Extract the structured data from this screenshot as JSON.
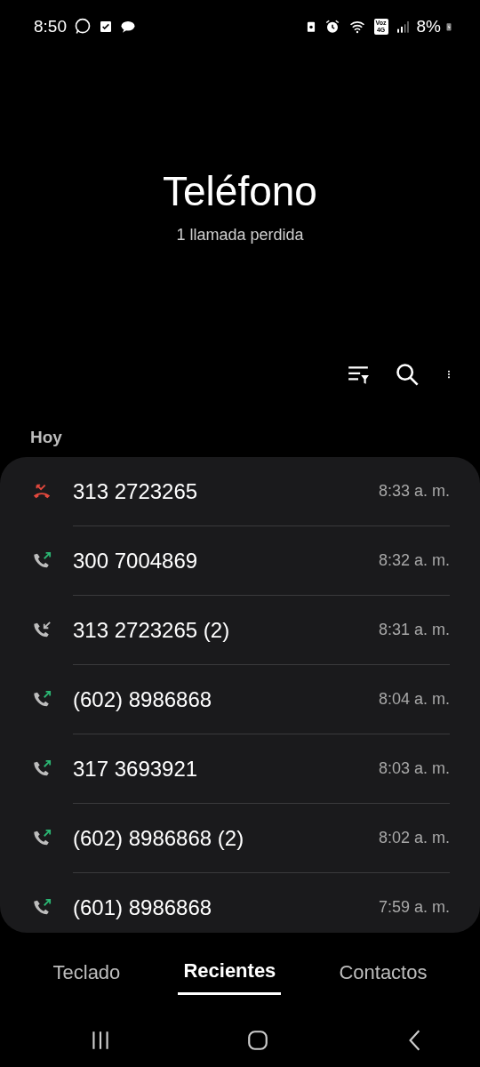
{
  "status_bar": {
    "time": "8:50",
    "network_label_top": "Voz",
    "network_label_bottom": "4G",
    "battery": "8%"
  },
  "header": {
    "title": "Teléfono",
    "subtitle": "1 llamada perdida"
  },
  "section": "Hoy",
  "calls": [
    {
      "kind": "missed",
      "number": "313 2723265",
      "time": "8:33 a. m."
    },
    {
      "kind": "outgoing",
      "number": "300 7004869",
      "time": "8:32 a. m."
    },
    {
      "kind": "incoming",
      "number": "313 2723265 (2)",
      "time": "8:31 a. m."
    },
    {
      "kind": "outgoing",
      "number": "(602) 8986868",
      "time": "8:04 a. m."
    },
    {
      "kind": "outgoing",
      "number": "317 3693921",
      "time": "8:03 a. m."
    },
    {
      "kind": "outgoing",
      "number": "(602) 8986868 (2)",
      "time": "8:02 a. m."
    },
    {
      "kind": "outgoing",
      "number": "(601) 8986868",
      "time": "7:59 a. m."
    }
  ],
  "tabs": [
    {
      "label": "Teclado",
      "selected": false
    },
    {
      "label": "Recientes",
      "selected": true
    },
    {
      "label": "Contactos",
      "selected": false
    }
  ]
}
